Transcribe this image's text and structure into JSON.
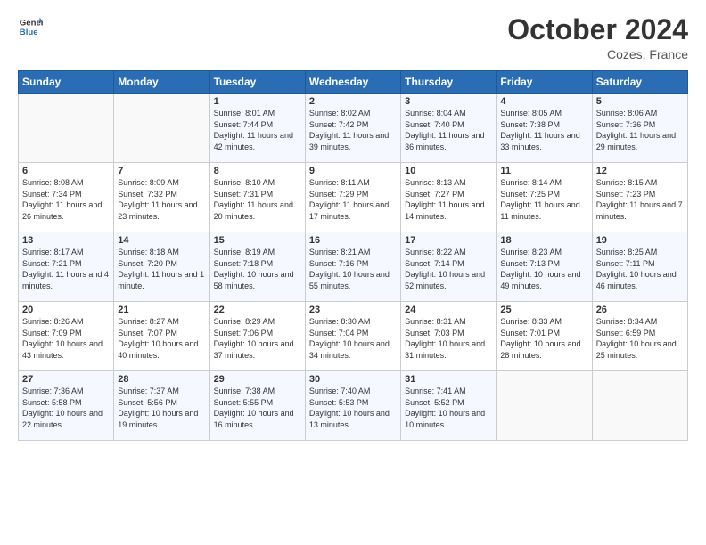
{
  "header": {
    "logo_line1": "General",
    "logo_line2": "Blue",
    "title": "October 2024",
    "location": "Cozes, France"
  },
  "days_of_week": [
    "Sunday",
    "Monday",
    "Tuesday",
    "Wednesday",
    "Thursday",
    "Friday",
    "Saturday"
  ],
  "weeks": [
    [
      {
        "day": "",
        "info": ""
      },
      {
        "day": "",
        "info": ""
      },
      {
        "day": "1",
        "info": "Sunrise: 8:01 AM\nSunset: 7:44 PM\nDaylight: 11 hours and 42 minutes."
      },
      {
        "day": "2",
        "info": "Sunrise: 8:02 AM\nSunset: 7:42 PM\nDaylight: 11 hours and 39 minutes."
      },
      {
        "day": "3",
        "info": "Sunrise: 8:04 AM\nSunset: 7:40 PM\nDaylight: 11 hours and 36 minutes."
      },
      {
        "day": "4",
        "info": "Sunrise: 8:05 AM\nSunset: 7:38 PM\nDaylight: 11 hours and 33 minutes."
      },
      {
        "day": "5",
        "info": "Sunrise: 8:06 AM\nSunset: 7:36 PM\nDaylight: 11 hours and 29 minutes."
      }
    ],
    [
      {
        "day": "6",
        "info": "Sunrise: 8:08 AM\nSunset: 7:34 PM\nDaylight: 11 hours and 26 minutes."
      },
      {
        "day": "7",
        "info": "Sunrise: 8:09 AM\nSunset: 7:32 PM\nDaylight: 11 hours and 23 minutes."
      },
      {
        "day": "8",
        "info": "Sunrise: 8:10 AM\nSunset: 7:31 PM\nDaylight: 11 hours and 20 minutes."
      },
      {
        "day": "9",
        "info": "Sunrise: 8:11 AM\nSunset: 7:29 PM\nDaylight: 11 hours and 17 minutes."
      },
      {
        "day": "10",
        "info": "Sunrise: 8:13 AM\nSunset: 7:27 PM\nDaylight: 11 hours and 14 minutes."
      },
      {
        "day": "11",
        "info": "Sunrise: 8:14 AM\nSunset: 7:25 PM\nDaylight: 11 hours and 11 minutes."
      },
      {
        "day": "12",
        "info": "Sunrise: 8:15 AM\nSunset: 7:23 PM\nDaylight: 11 hours and 7 minutes."
      }
    ],
    [
      {
        "day": "13",
        "info": "Sunrise: 8:17 AM\nSunset: 7:21 PM\nDaylight: 11 hours and 4 minutes."
      },
      {
        "day": "14",
        "info": "Sunrise: 8:18 AM\nSunset: 7:20 PM\nDaylight: 11 hours and 1 minute."
      },
      {
        "day": "15",
        "info": "Sunrise: 8:19 AM\nSunset: 7:18 PM\nDaylight: 10 hours and 58 minutes."
      },
      {
        "day": "16",
        "info": "Sunrise: 8:21 AM\nSunset: 7:16 PM\nDaylight: 10 hours and 55 minutes."
      },
      {
        "day": "17",
        "info": "Sunrise: 8:22 AM\nSunset: 7:14 PM\nDaylight: 10 hours and 52 minutes."
      },
      {
        "day": "18",
        "info": "Sunrise: 8:23 AM\nSunset: 7:13 PM\nDaylight: 10 hours and 49 minutes."
      },
      {
        "day": "19",
        "info": "Sunrise: 8:25 AM\nSunset: 7:11 PM\nDaylight: 10 hours and 46 minutes."
      }
    ],
    [
      {
        "day": "20",
        "info": "Sunrise: 8:26 AM\nSunset: 7:09 PM\nDaylight: 10 hours and 43 minutes."
      },
      {
        "day": "21",
        "info": "Sunrise: 8:27 AM\nSunset: 7:07 PM\nDaylight: 10 hours and 40 minutes."
      },
      {
        "day": "22",
        "info": "Sunrise: 8:29 AM\nSunset: 7:06 PM\nDaylight: 10 hours and 37 minutes."
      },
      {
        "day": "23",
        "info": "Sunrise: 8:30 AM\nSunset: 7:04 PM\nDaylight: 10 hours and 34 minutes."
      },
      {
        "day": "24",
        "info": "Sunrise: 8:31 AM\nSunset: 7:03 PM\nDaylight: 10 hours and 31 minutes."
      },
      {
        "day": "25",
        "info": "Sunrise: 8:33 AM\nSunset: 7:01 PM\nDaylight: 10 hours and 28 minutes."
      },
      {
        "day": "26",
        "info": "Sunrise: 8:34 AM\nSunset: 6:59 PM\nDaylight: 10 hours and 25 minutes."
      }
    ],
    [
      {
        "day": "27",
        "info": "Sunrise: 7:36 AM\nSunset: 5:58 PM\nDaylight: 10 hours and 22 minutes."
      },
      {
        "day": "28",
        "info": "Sunrise: 7:37 AM\nSunset: 5:56 PM\nDaylight: 10 hours and 19 minutes."
      },
      {
        "day": "29",
        "info": "Sunrise: 7:38 AM\nSunset: 5:55 PM\nDaylight: 10 hours and 16 minutes."
      },
      {
        "day": "30",
        "info": "Sunrise: 7:40 AM\nSunset: 5:53 PM\nDaylight: 10 hours and 13 minutes."
      },
      {
        "day": "31",
        "info": "Sunrise: 7:41 AM\nSunset: 5:52 PM\nDaylight: 10 hours and 10 minutes."
      },
      {
        "day": "",
        "info": ""
      },
      {
        "day": "",
        "info": ""
      }
    ]
  ]
}
